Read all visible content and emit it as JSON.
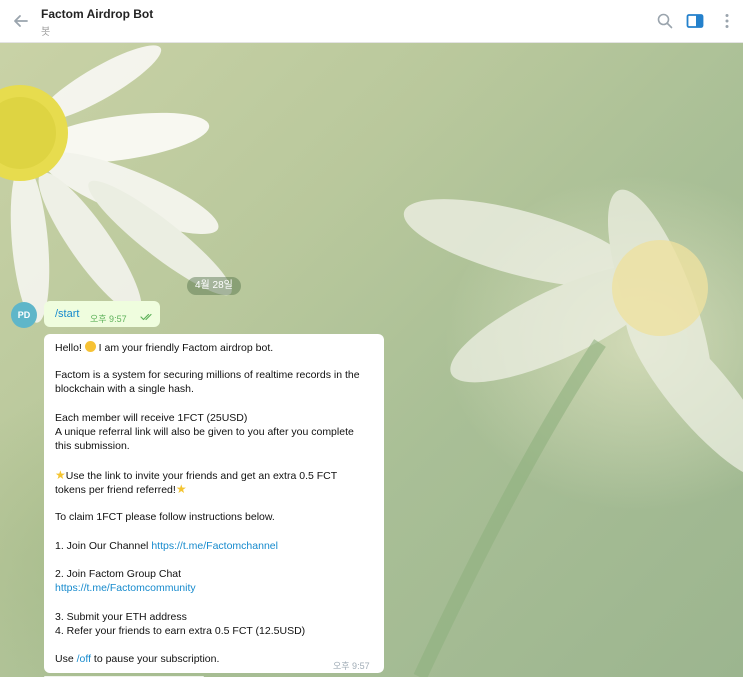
{
  "header": {
    "title": "Factom Airdrop Bot",
    "subtitle": "봇"
  },
  "chat": {
    "date_pill": "4월 28일",
    "avatar_initials": "PD",
    "outgoing": {
      "text": "/start",
      "time": "오후 9:57"
    },
    "incoming": {
      "time": "오후 9:57",
      "greeting_before": "Hello! ",
      "greeting_after": " I am your friendly Factom airdrop bot.",
      "desc_line1": "Factom is a system for securing millions of realtime records in the",
      "desc_line2": "blockchain with a single hash.",
      "member_line": "Each member will receive 1FCT (25USD)",
      "referral_line1": "A unique referral link will also be given to you after you complete",
      "referral_line2": "this submission.",
      "invite_line1": "Use the link to invite your friends and get an extra 0.5 FCT",
      "invite_line2": "tokens per friend referred!",
      "claim_line": "To claim 1FCT please follow instructions below.",
      "step1_text": "1. Join Our Channel ",
      "step1_link": "https://t.me/Factomchannel",
      "step2_text": "2. Join Factom Group Chat",
      "step2_link": "https://t.me/Factomcommunity",
      "step3": "3. Submit your ETH address",
      "step4": "4. Refer your friends to earn extra 0.5 FCT (12.5USD)",
      "off_before": "Use ",
      "off_link": "/off",
      "off_after": " to pause your subscription."
    }
  },
  "colors": {
    "link": "#168acd",
    "outgoing_bubble": "#effdde",
    "accent": "#2481cc"
  },
  "icons": {
    "back": "arrow-left-icon",
    "search": "search-icon",
    "panel": "sidebar-toggle-icon",
    "more": "more-vertical-icon",
    "read": "double-check-icon",
    "smile": "grinning-face-emoji",
    "star": "star-emoji"
  }
}
